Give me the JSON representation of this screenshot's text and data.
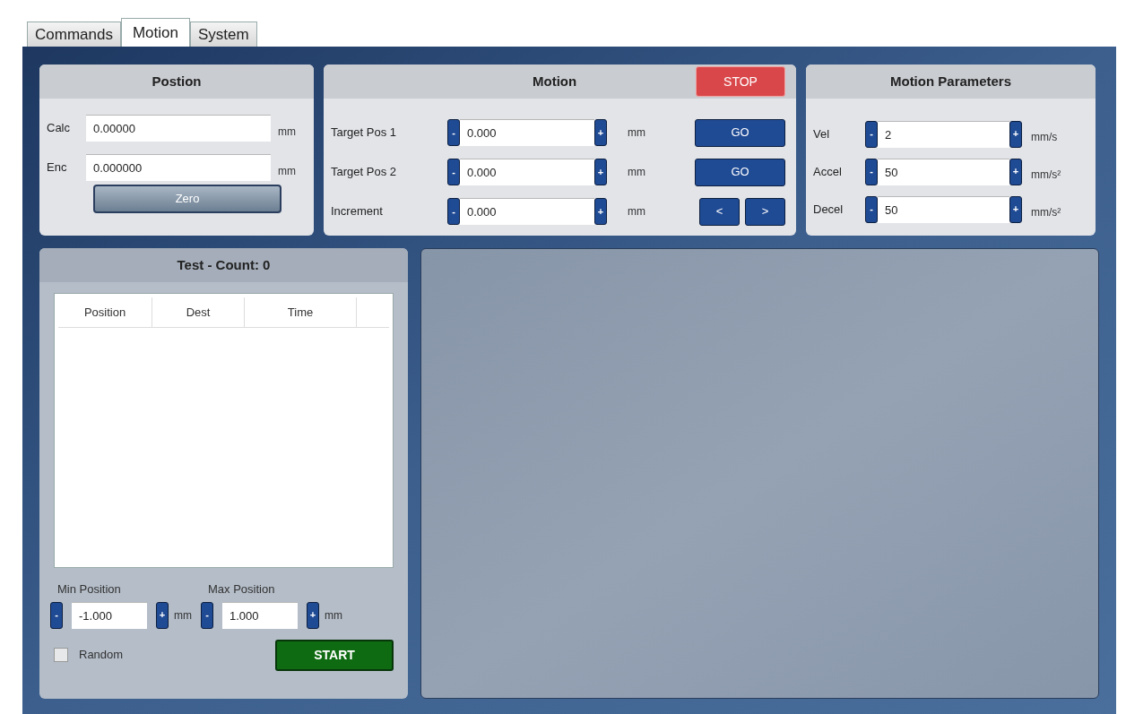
{
  "tabs": [
    {
      "label": "Commands",
      "selected": false
    },
    {
      "label": "Motion",
      "selected": true
    },
    {
      "label": "System",
      "selected": false
    }
  ],
  "position": {
    "title": "Postion",
    "fields": [
      {
        "label": "Calc",
        "value": "0.00000",
        "unit": "mm"
      },
      {
        "label": "Enc",
        "value": "0.000000",
        "unit": "mm"
      }
    ],
    "zero_button": "Zero"
  },
  "motion": {
    "title": "Motion",
    "stop_button": "STOP",
    "rows": [
      {
        "label": "Target Pos 1",
        "value": "0.000",
        "unit": "mm",
        "kind": "go",
        "buttons": [
          "GO"
        ]
      },
      {
        "label": "Target Pos 2",
        "value": "0.000",
        "unit": "mm",
        "kind": "go",
        "buttons": [
          "GO"
        ]
      },
      {
        "label": "Increment",
        "value": "0.000",
        "unit": "mm",
        "kind": "step",
        "buttons": [
          "<",
          ">"
        ]
      }
    ]
  },
  "motion_parameters": {
    "title": "Motion Parameters",
    "rows": [
      {
        "label": "Vel",
        "value": "2",
        "unit": "mm/s"
      },
      {
        "label": "Accel",
        "value": "50",
        "unit": "mm/s²"
      },
      {
        "label": "Decel",
        "value": "50",
        "unit": "mm/s²"
      }
    ]
  },
  "stepper": {
    "minus": "-",
    "plus": "+"
  },
  "test": {
    "title": "Test - Count: 0",
    "table": {
      "columns": [
        "Position",
        "Dest",
        "Time"
      ]
    },
    "limits": [
      {
        "label": "Min Position",
        "value": "-1.000",
        "unit": "mm"
      },
      {
        "label": "Max Position",
        "value": "1.000",
        "unit": "mm"
      }
    ],
    "random": {
      "label": "Random",
      "checked": false
    },
    "start_button": "START"
  }
}
